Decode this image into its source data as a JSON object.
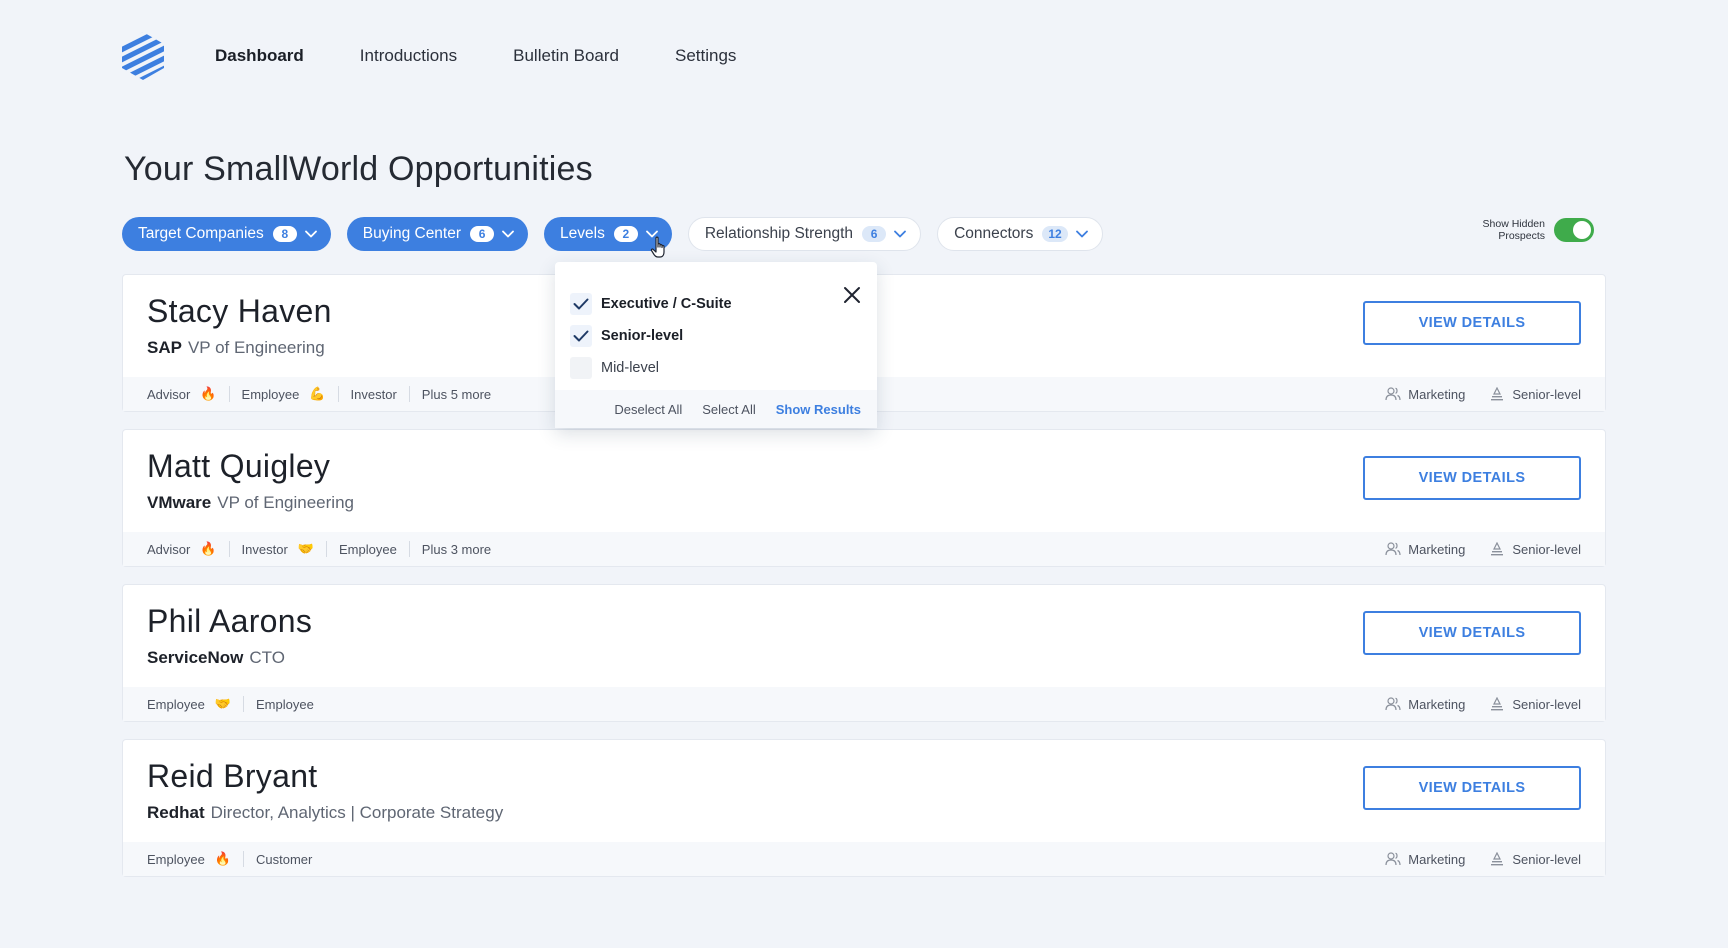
{
  "nav": {
    "links": [
      {
        "label": "Dashboard",
        "active": true
      },
      {
        "label": "Introductions",
        "active": false
      },
      {
        "label": "Bulletin Board",
        "active": false
      },
      {
        "label": "Settings",
        "active": false
      }
    ]
  },
  "page": {
    "title": "Your SmallWorld Opportunities"
  },
  "filters": [
    {
      "label": "Target Companies",
      "count": "8",
      "active": true
    },
    {
      "label": "Buying Center",
      "count": "6",
      "active": true
    },
    {
      "label": "Levels",
      "count": "2",
      "active": true
    },
    {
      "label": "Relationship Strength",
      "count": "6",
      "active": false
    },
    {
      "label": "Connectors",
      "count": "12",
      "active": false
    }
  ],
  "hidden_prospects": {
    "label_line1": "Show Hidden",
    "label_line2": "Prospects",
    "on": true
  },
  "levels_dropdown": {
    "options": [
      {
        "label": "Executive / C-Suite",
        "checked": true
      },
      {
        "label": "Senior-level",
        "checked": true
      },
      {
        "label": "Mid-level",
        "checked": false
      }
    ],
    "deselect_all": "Deselect All",
    "select_all": "Select All",
    "show_results": "Show Results"
  },
  "prospects": [
    {
      "name": "Stacy Haven",
      "company": "SAP",
      "title": "VP of Engineering",
      "tags": [
        {
          "label": "Advisor",
          "emoji": "🔥"
        },
        {
          "label": "Employee",
          "emoji": "💪"
        },
        {
          "label": "Investor",
          "emoji": ""
        },
        {
          "label": "Plus 5 more",
          "emoji": ""
        }
      ],
      "department": "Marketing",
      "level": "Senior-level",
      "button": "VIEW DETAILS"
    },
    {
      "name": "Matt Quigley",
      "company": "VMware",
      "title": "VP of Engineering",
      "tags": [
        {
          "label": "Advisor",
          "emoji": "🔥"
        },
        {
          "label": "Investor",
          "emoji": "🤝"
        },
        {
          "label": "Employee",
          "emoji": ""
        },
        {
          "label": "Plus 3 more",
          "emoji": ""
        }
      ],
      "department": "Marketing",
      "level": "Senior-level",
      "button": "VIEW DETAILS"
    },
    {
      "name": "Phil Aarons",
      "company": "ServiceNow",
      "title": "CTO",
      "tags": [
        {
          "label": "Employee",
          "emoji": "🤝"
        },
        {
          "label": "Employee",
          "emoji": ""
        }
      ],
      "department": "Marketing",
      "level": "Senior-level",
      "button": "VIEW DETAILS"
    },
    {
      "name": "Reid Bryant",
      "company": "Redhat",
      "title": "Director, Analytics | Corporate Strategy",
      "tags": [
        {
          "label": "Employee",
          "emoji": "🔥"
        },
        {
          "label": "Customer",
          "emoji": ""
        }
      ],
      "department": "Marketing",
      "level": "Senior-level",
      "button": "VIEW DETAILS"
    }
  ],
  "colors": {
    "accent": "#3d7fe0",
    "toggle_on": "#3fab4b",
    "background": "#f1f4f9"
  },
  "icons": {
    "logo": "striped-hexagon-logo",
    "department": "people-icon",
    "level": "level-icon",
    "chevron": "chevron-down-icon",
    "close": "close-icon",
    "check": "check-icon"
  }
}
